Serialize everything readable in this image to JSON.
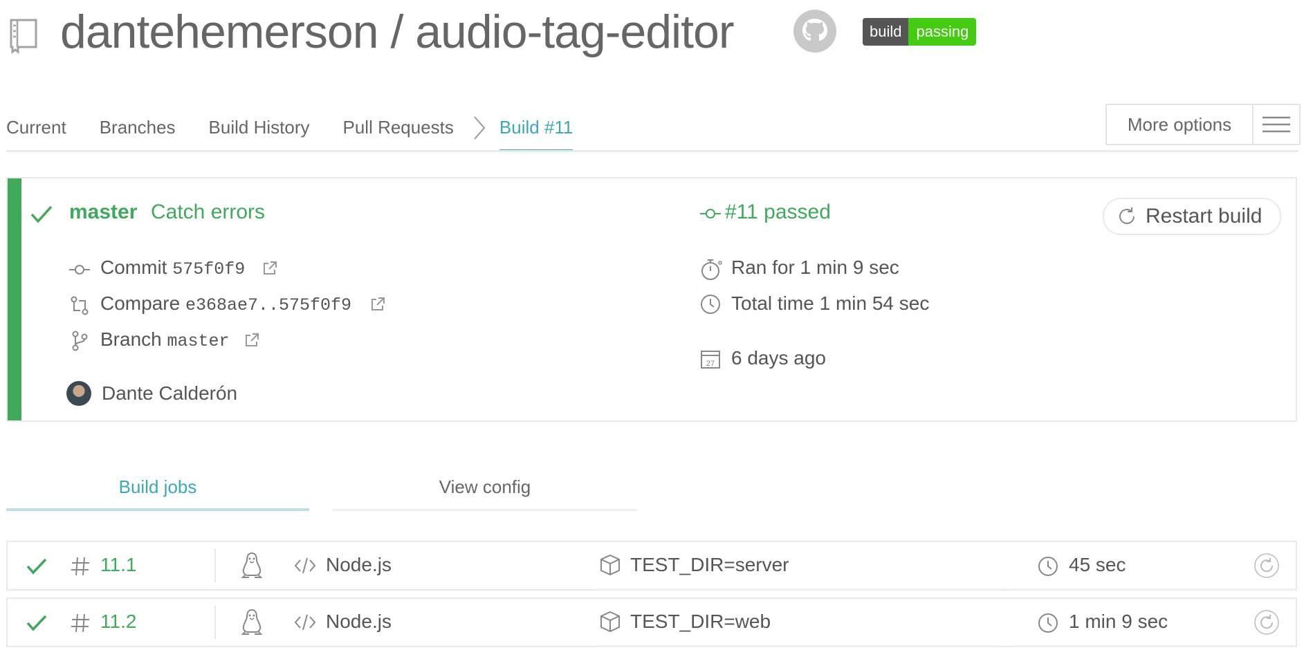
{
  "header": {
    "title": "dantehemerson / audio-tag-editor",
    "badge_left": "build",
    "badge_right": "passing"
  },
  "nav": {
    "items": [
      "Current",
      "Branches",
      "Build History",
      "Pull Requests"
    ],
    "active": "Build #11",
    "more_options": "More options"
  },
  "build": {
    "branch": "master",
    "message": "Catch errors",
    "status": "#11 passed",
    "restart_label": "Restart build",
    "commit_label": "Commit",
    "commit_hash": "575f0f9",
    "compare_label": "Compare",
    "compare_range": "e368ae7..575f0f9",
    "branch_label": "Branch",
    "branch_value": "master",
    "author": "Dante Calderón",
    "ran_for": "Ran for 1 min 9 sec",
    "total_time": "Total time 1 min 54 sec",
    "calendar_day": "27",
    "date": "6 days ago"
  },
  "tabs": {
    "build_jobs": "Build jobs",
    "view_config": "View config"
  },
  "jobs": [
    {
      "number": "11.1",
      "language": "Node.js",
      "env": "TEST_DIR=server",
      "duration": "45 sec"
    },
    {
      "number": "11.2",
      "language": "Node.js",
      "env": "TEST_DIR=web",
      "duration": "1 min 9 sec"
    }
  ],
  "colors": {
    "passed_green": "#3eaa5a",
    "accent_teal": "#39a9b7",
    "badge_green": "#44cc11",
    "badge_gray": "#555555"
  }
}
